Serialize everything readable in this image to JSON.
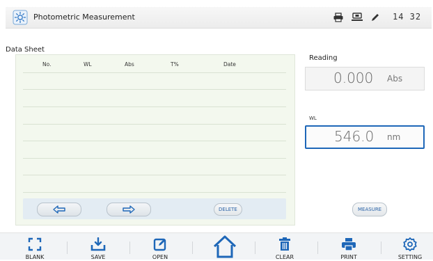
{
  "header": {
    "title": "Photometric Measurement",
    "time": "14 32"
  },
  "sheet": {
    "title": "Data Sheet",
    "columns": [
      "No.",
      "WL",
      "Abs",
      "T%",
      "Date"
    ],
    "rows": [],
    "delete_label": "DELETE"
  },
  "reading": {
    "label": "Reading",
    "value": "0.000",
    "unit": "Abs"
  },
  "wavelength": {
    "label": "WL",
    "value": "546.0",
    "unit": "nm"
  },
  "measure_label": "MEASURE",
  "nav": {
    "blank": "BLANK",
    "save": "SAVE",
    "open": "OPEN",
    "clear": "CLEAR",
    "print": "PRINT",
    "setting": "SETTING"
  },
  "colors": {
    "accent": "#1e67b8",
    "icon": "#1e67b8"
  }
}
